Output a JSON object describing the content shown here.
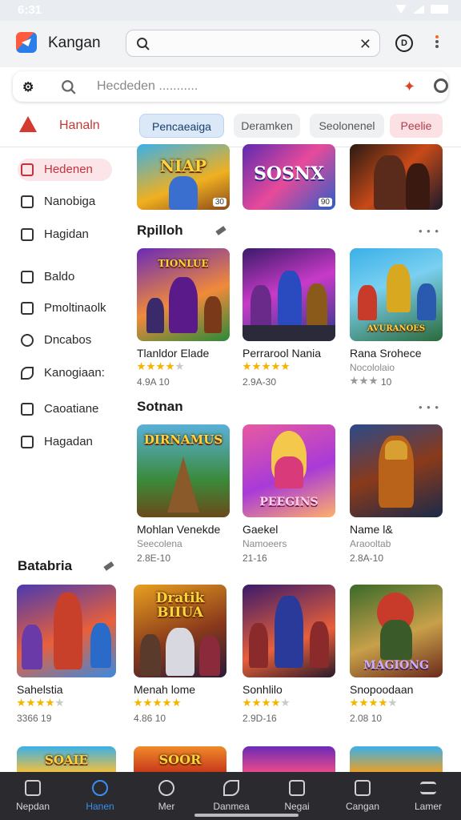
{
  "status": {
    "time": "6:31"
  },
  "header": {
    "app_name": "Kangan"
  },
  "search": {
    "placeholder": "Hecdeden ..........."
  },
  "brand": {
    "label": "Hanaln"
  },
  "chips": [
    "Pencaeaiga",
    "Deramken",
    "Seolonenel",
    "Peelie"
  ],
  "sidebar": {
    "items": [
      {
        "label": "Hedenen",
        "icon": "bookmark-icon",
        "active": true
      },
      {
        "label": "Nanobiga",
        "icon": "folder-icon"
      },
      {
        "label": "Hagidan",
        "icon": "home-icon"
      },
      {
        "label": "Baldo",
        "icon": "chat-icon"
      },
      {
        "label": "Pmoltinaolk",
        "icon": "document-icon"
      },
      {
        "label": "Dncabos",
        "icon": "clock-icon"
      },
      {
        "label": "Kanogiaan:",
        "icon": "leaf-icon"
      },
      {
        "label": "Caoatiane",
        "icon": "card-icon"
      },
      {
        "label": "Hagadan",
        "icon": "store-icon"
      }
    ]
  },
  "sections": {
    "s1": {
      "title": "Rpilloh"
    },
    "s2": {
      "title": "Sotnan"
    },
    "s3": {
      "title": "Batabria"
    }
  },
  "top_cards": [
    {
      "art": "NIAP",
      "badge": "30"
    },
    {
      "art": "SOSNX",
      "badge": "90"
    },
    {
      "art": "",
      "badge": ""
    }
  ],
  "row1": [
    {
      "title": "Tlanldor Elade",
      "meta": "4.9A 10",
      "art": "TIONLUE",
      "stars": 4
    },
    {
      "title": "Perrarool Nania",
      "meta": "2.9A-30",
      "art": "",
      "stars": 5
    },
    {
      "title": "Rana Srohece",
      "sub": "Nocololaio",
      "meta": "10",
      "art": "AVURANOES",
      "stars": 3
    }
  ],
  "row2": [
    {
      "title": "Mohlan Venekde",
      "sub": "Seecolena",
      "meta": "2.8E-10",
      "art": "DIRNAMUS"
    },
    {
      "title": "Gaekel",
      "sub": "Namoeers",
      "meta": "21-16",
      "art": "PEEGINS"
    },
    {
      "title": "Name l&",
      "sub": "Araooltab",
      "meta": "2.8A-10",
      "art": ""
    }
  ],
  "row3": [
    {
      "title": "Sahelstia",
      "meta": "3366 19",
      "art": "",
      "stars": 4
    },
    {
      "title": "Menah lome",
      "meta": "4.86 10",
      "art": "Dratik BIIUA",
      "stars": 5
    },
    {
      "title": "Sonhlilo",
      "meta": "2.9D-16",
      "art": "",
      "stars": 4
    },
    {
      "title": "Snopoodaan",
      "meta": "2.08 10",
      "art": "MAGIONG",
      "stars": 4
    }
  ],
  "row4_art": [
    "SOAIE",
    "SOOR",
    "",
    ""
  ],
  "bottom_nav": [
    {
      "label": "Nepdan",
      "icon": "home-icon"
    },
    {
      "label": "Hanen",
      "icon": "compass-icon",
      "active": true
    },
    {
      "label": "Mer",
      "icon": "search-icon"
    },
    {
      "label": "Danmea",
      "icon": "leaf-icon"
    },
    {
      "label": "Negai",
      "icon": "store-icon"
    },
    {
      "label": "Cangan",
      "icon": "gallery-icon"
    },
    {
      "label": "Lamer",
      "icon": "menu-icon"
    }
  ],
  "colors": {
    "accent": "#3a8ef0",
    "brand": "#c43a32",
    "active_sidebar": "#c0343e"
  }
}
